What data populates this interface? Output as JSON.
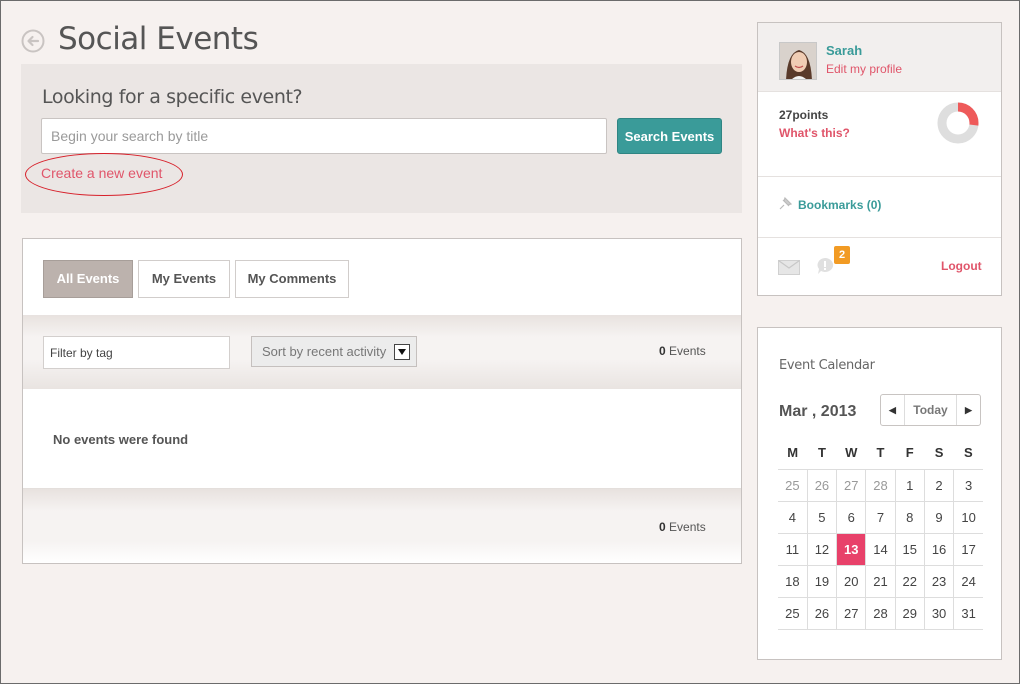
{
  "header": {
    "title": "Social Events",
    "back_icon": "back-arrow-icon"
  },
  "search": {
    "heading": "Looking for a specific event?",
    "placeholder": "Begin your search by title",
    "button_label": "Search Events",
    "create_link": "Create a new event"
  },
  "events": {
    "tabs": [
      {
        "label": "All Events",
        "active": true
      },
      {
        "label": "My Events",
        "active": false
      },
      {
        "label": "My Comments",
        "active": false
      }
    ],
    "filter_placeholder": "Filter by tag",
    "sort_selected": "Sort by recent activity",
    "count_value": "0",
    "count_label": "Events",
    "empty_message": "No events were found"
  },
  "profile": {
    "name": "Sarah",
    "edit_link": "Edit my profile",
    "points": "27points",
    "whats_this": "What's this?",
    "points_progress": 0.27,
    "bookmarks": "Bookmarks (0)",
    "notification_count": "2",
    "logout": "Logout"
  },
  "calendar": {
    "title": "Event Calendar",
    "month": "Mar , 2013",
    "today_label": "Today",
    "weekdays": [
      "M",
      "T",
      "W",
      "T",
      "F",
      "S",
      "S"
    ],
    "weeks": [
      [
        "25",
        "26",
        "27",
        "28",
        "1",
        "2",
        "3"
      ],
      [
        "4",
        "5",
        "6",
        "7",
        "8",
        "9",
        "10"
      ],
      [
        "11",
        "12",
        "13",
        "14",
        "15",
        "16",
        "17"
      ],
      [
        "18",
        "19",
        "20",
        "21",
        "22",
        "23",
        "24"
      ],
      [
        "25",
        "26",
        "27",
        "28",
        "29",
        "30",
        "31"
      ]
    ],
    "today": "13"
  },
  "colors": {
    "accent_teal": "#3a9b99",
    "accent_pink": "#e0556a",
    "today_highlight": "#e8416a",
    "badge": "#f29b24"
  }
}
